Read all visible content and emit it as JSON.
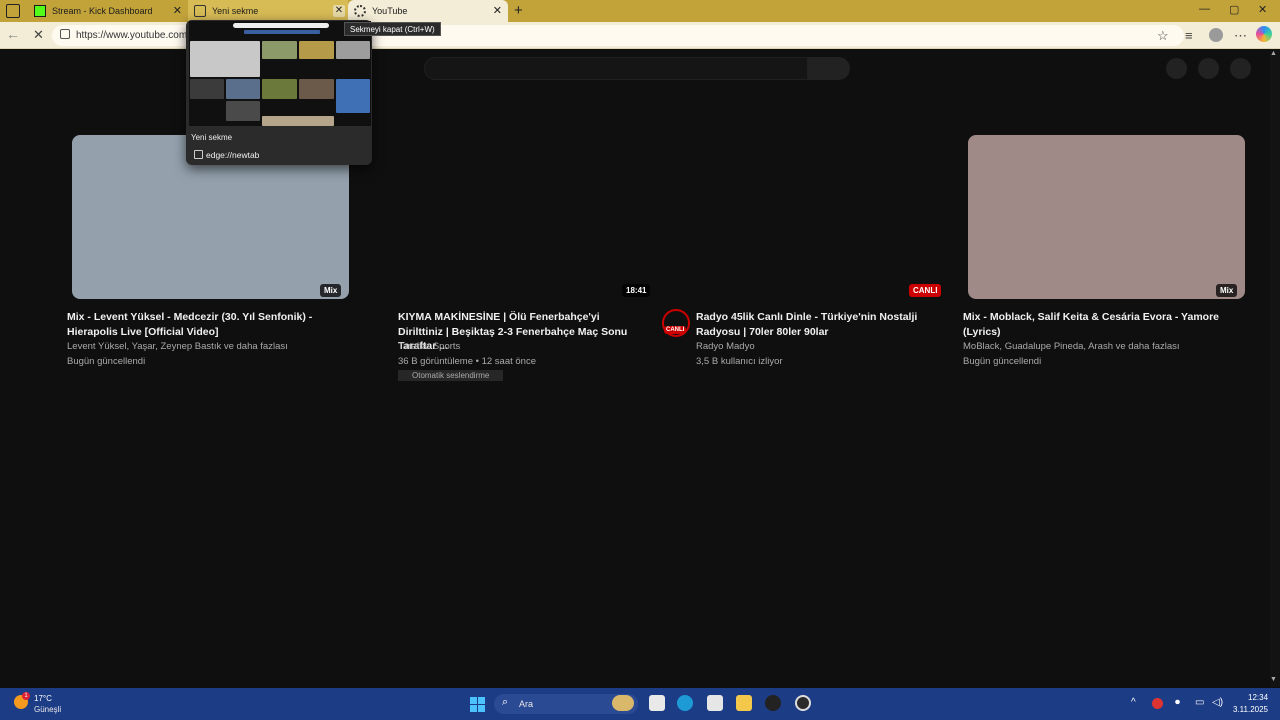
{
  "browser": {
    "tabs": [
      {
        "label": "Stream - Kick Dashboard"
      },
      {
        "label": "Yeni sekme"
      },
      {
        "label": "YouTube"
      }
    ],
    "close_glyph": "✕",
    "new_tab_glyph": "+",
    "url": "https://www.youtube.com",
    "tooltip": "Sekmeyi kapat (Ctrl+W)",
    "window_controls": {
      "minimize": "—",
      "maximize": "▢",
      "close": "✕"
    },
    "tab_preview": {
      "title": "Yeni sekme",
      "url": "edge://newtab"
    }
  },
  "videos": [
    {
      "title": "Mix - Levent Yüksel - Medcezir (30. Yıl Senfonik) - Hierapolis Live [Official Video]",
      "channel": "Levent Yüksel, Yaşar, Zeynep Bastık ve daha fazlası",
      "meta": "Bugün güncellendi",
      "badge": "Mix",
      "thumb_color": "#94a1ad"
    },
    {
      "title": "KIYMA MAKİNESİNE | Ölü Fenerbahçe'yi Dirilttiniz | Beşiktaş 2-3 Fenerbahçe Maç Sonu Taraftar ...",
      "channel": "Taraftar Sports",
      "meta": "36 B görüntüleme • 12 saat önce",
      "badge": "18:41",
      "chip": "Otomatik seslendirme",
      "thumb_color": "#0f0f0f"
    },
    {
      "title": "Radyo 45lik Canlı Dinle - Türkiye'nin Nostalji Radyosu | 70ler 80ler 90lar",
      "channel": "Radyo Madyo",
      "meta": "3,5 B kullanıcı izliyor",
      "badge": "CANLI",
      "avatar_badge": "CANLI",
      "thumb_color": "#0f0f0f"
    },
    {
      "title": "Mix - Moblack, Salif Keita & Cesária Evora - Yamore (Lyrics)",
      "channel": "MoBlack, Guadalupe Pineda, Arash ve daha fazlası",
      "meta": "Bugün güncellendi",
      "badge": "Mix",
      "thumb_color": "#9f8a87"
    }
  ],
  "taskbar": {
    "weather_temp": "17°C",
    "weather_desc": "Güneşli",
    "weather_badge": "1",
    "search_label": "Ara",
    "time": "12:34",
    "date": "3.11.2025"
  },
  "colors": {
    "tab_strip": "#c2a33a",
    "live_red": "#cc0000",
    "taskbar": "#1d3c86"
  }
}
